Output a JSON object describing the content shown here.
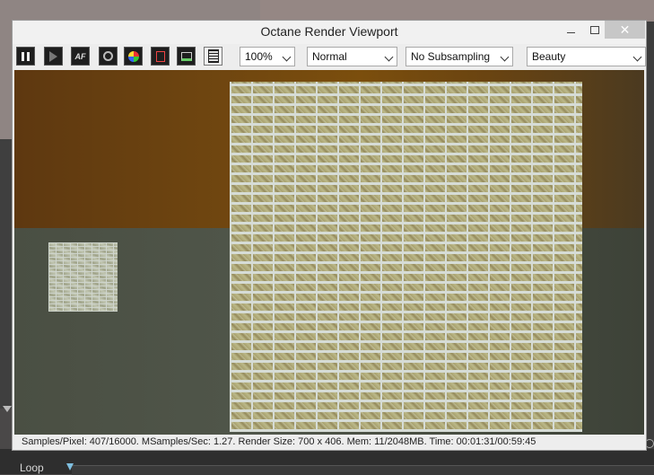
{
  "window": {
    "title": "Octane Render Viewport",
    "close_glyph": "✕"
  },
  "toolbar": {
    "buttons": [
      {
        "name": "pause-icon"
      },
      {
        "name": "play-icon"
      },
      {
        "name": "autofocus-icon",
        "label": "AF"
      },
      {
        "name": "film-settings-icon"
      },
      {
        "name": "color-pick-icon"
      },
      {
        "name": "render-region-icon"
      },
      {
        "name": "export-icon"
      },
      {
        "name": "settings-list-icon"
      }
    ],
    "zoom": "100%",
    "mode": "Normal",
    "subsampling": "No Subsampling",
    "pass": "Beauty"
  },
  "status": {
    "text": "Samples/Pixel: 407/16000. MSamples/Sec: 1.27. Render Size: 700 x 406. Mem: 11/2048MB. Time: 00:01:31/00:59:45"
  },
  "timeline": {
    "loop_label": "Loop"
  }
}
